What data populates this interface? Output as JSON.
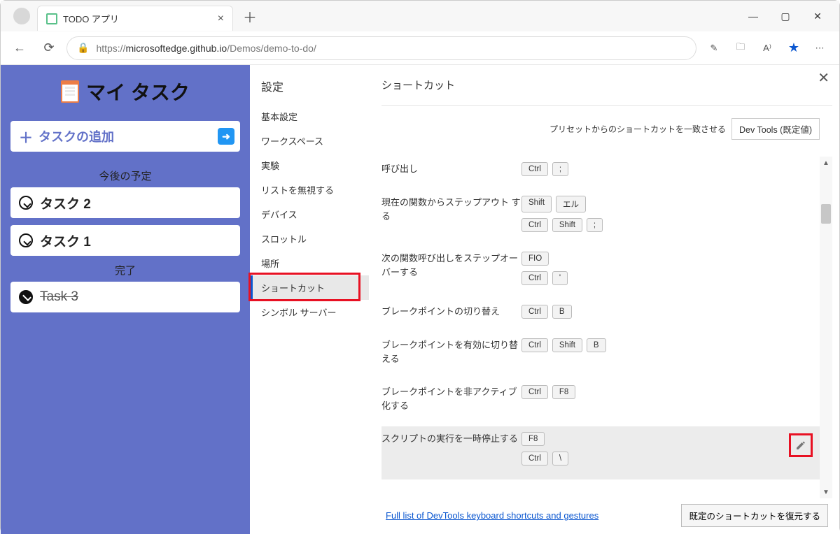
{
  "browser": {
    "tab_title": "TODO アプリ",
    "url_prefix": "https://",
    "url_host": "microsoftedge.github.io",
    "url_path": "/Demos/demo-to-do/"
  },
  "todo": {
    "title": "マイ タスク",
    "add_label": "タスクの追加",
    "upcoming_label": "今後の予定",
    "done_label": "完了",
    "tasks_open": [
      "タスク 2",
      "タスク 1"
    ],
    "tasks_done": [
      "Task 3"
    ]
  },
  "settings": {
    "heading": "設定",
    "nav": [
      "基本設定",
      "ワークスペース",
      "実験",
      "リストを無視する",
      "デバイス",
      "スロットル",
      "場所",
      "ショートカット",
      "シンボル サーバー"
    ],
    "selected_index": 7,
    "main_title": "ショートカット",
    "preset_label": "プリセットからのショートカットを一致させる",
    "preset_value": "Dev Tools (既定値)",
    "shortcuts": [
      {
        "label": "呼び出し",
        "keys": [
          [
            "Ctrl",
            ";"
          ]
        ]
      },
      {
        "label": "現在の関数からステップアウト する",
        "keys": [
          [
            "Shift",
            "エル"
          ],
          [
            "Ctrl",
            "Shift",
            ";"
          ]
        ]
      },
      {
        "label": "次の関数呼び出しをステップオーバーする",
        "keys": [
          [
            "FIO"
          ],
          [
            "Ctrl",
            "'"
          ]
        ]
      },
      {
        "label": "ブレークポイントの切り替え",
        "keys": [
          [
            "Ctrl",
            "B"
          ]
        ]
      },
      {
        "label": "ブレークポイントを有効に切り替える",
        "keys": [
          [
            "Ctrl",
            "Shift",
            "B"
          ]
        ]
      },
      {
        "label": "ブレークポイントを非アクティブ化する",
        "keys": [
          [
            "Ctrl",
            "F8"
          ]
        ]
      },
      {
        "label": "スクリプトの実行を一時停止する",
        "keys": [
          [
            "F8"
          ],
          [
            "Ctrl",
            "\\"
          ]
        ],
        "highlighted": true
      }
    ],
    "link_text": "Full list of DevTools keyboard shortcuts and gestures",
    "restore_label": "既定のショートカットを復元する"
  }
}
